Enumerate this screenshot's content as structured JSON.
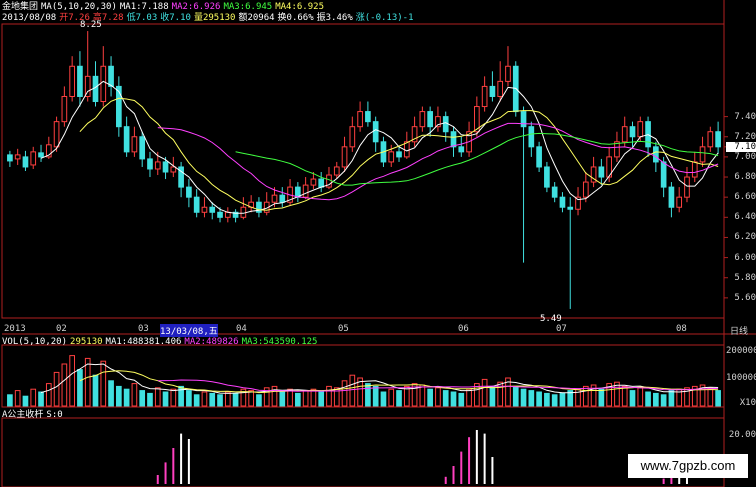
{
  "colors": {
    "up": "#ff4040",
    "down": "#40e0e0",
    "ma1": "#ffffff",
    "ma2": "#ff40ff",
    "ma3": "#40ff40",
    "ma4": "#ffff60",
    "axis": "#b02020"
  },
  "header1": {
    "name": "金地集团",
    "ma_label": "MA(5,10,20,30)",
    "ma1": "MA1:7.188",
    "ma2": "MA2:6.926",
    "ma3": "MA3:6.945",
    "ma4": "MA4:6.925"
  },
  "header2": {
    "date": "2013/08/08",
    "open": "开7.26",
    "high": "高7.28",
    "low": "低7.03",
    "close": "收7.10",
    "vol": "量295130",
    "amount": "额20964",
    "turnover": "换0.66%",
    "amplitude": "振3.46%",
    "change": "涨(-0.13)-1"
  },
  "price_annotations": {
    "high": "8.25",
    "low": "5.49"
  },
  "price_axis": [
    "7.40",
    "7.20",
    "7.10",
    "7.00",
    "6.80",
    "6.60",
    "6.40",
    "6.20",
    "6.00",
    "5.80",
    "5.60"
  ],
  "dates": [
    "2013",
    "02",
    "03",
    "13/03/08,五",
    "04",
    "05",
    "06",
    "07",
    "08",
    "日线"
  ],
  "vol_header": {
    "label": "VOL(5,10,20)",
    "value": "295130",
    "ma1": "MA1:488381.406",
    "ma2": "MA2:489826",
    "ma3": "MA3:543590.125"
  },
  "vol_axis": [
    "200000",
    "100000",
    "X10"
  ],
  "indicator": {
    "label": "A公主收杆",
    "value": "S:0"
  },
  "ind_axis": [
    "20.00"
  ],
  "watermark": "www.7gpzb.com",
  "chart_data": {
    "type": "candlestick",
    "ylim": [
      5.4,
      8.3
    ],
    "candles": [
      [
        7.02,
        6.96,
        7.06,
        6.9
      ],
      [
        6.98,
        7.02,
        7.08,
        6.92
      ],
      [
        7.0,
        6.9,
        7.06,
        6.86
      ],
      [
        6.92,
        7.05,
        7.1,
        6.88
      ],
      [
        7.04,
        7.0,
        7.12,
        6.95
      ],
      [
        7.0,
        7.12,
        7.2,
        6.98
      ],
      [
        7.1,
        7.35,
        7.4,
        7.05
      ],
      [
        7.35,
        7.6,
        7.7,
        7.3
      ],
      [
        7.6,
        7.9,
        8.0,
        7.55
      ],
      [
        7.9,
        7.6,
        8.05,
        7.5
      ],
      [
        7.6,
        7.8,
        8.25,
        7.55
      ],
      [
        7.8,
        7.55,
        7.95,
        7.5
      ],
      [
        7.55,
        7.9,
        8.1,
        7.5
      ],
      [
        7.9,
        7.7,
        8.0,
        7.6
      ],
      [
        7.7,
        7.3,
        7.8,
        7.2
      ],
      [
        7.3,
        7.05,
        7.4,
        7.0
      ],
      [
        7.05,
        7.2,
        7.3,
        7.0
      ],
      [
        7.2,
        6.98,
        7.25,
        6.9
      ],
      [
        6.98,
        6.88,
        7.05,
        6.8
      ],
      [
        6.88,
        6.95,
        7.05,
        6.82
      ],
      [
        6.95,
        6.85,
        7.0,
        6.78
      ],
      [
        6.85,
        6.9,
        7.0,
        6.8
      ],
      [
        6.9,
        6.7,
        6.95,
        6.6
      ],
      [
        6.7,
        6.6,
        6.78,
        6.5
      ],
      [
        6.6,
        6.45,
        6.68,
        6.4
      ],
      [
        6.45,
        6.5,
        6.6,
        6.4
      ],
      [
        6.5,
        6.45,
        6.55,
        6.38
      ],
      [
        6.45,
        6.4,
        6.5,
        6.35
      ],
      [
        6.4,
        6.45,
        6.5,
        6.35
      ],
      [
        6.45,
        6.4,
        6.48,
        6.35
      ],
      [
        6.4,
        6.5,
        6.6,
        6.38
      ],
      [
        6.5,
        6.55,
        6.62,
        6.45
      ],
      [
        6.55,
        6.45,
        6.6,
        6.4
      ],
      [
        6.45,
        6.55,
        6.65,
        6.42
      ],
      [
        6.55,
        6.62,
        6.7,
        6.5
      ],
      [
        6.62,
        6.55,
        6.7,
        6.5
      ],
      [
        6.55,
        6.7,
        6.78,
        6.52
      ],
      [
        6.7,
        6.6,
        6.75,
        6.55
      ],
      [
        6.6,
        6.72,
        6.8,
        6.58
      ],
      [
        6.72,
        6.78,
        6.85,
        6.68
      ],
      [
        6.78,
        6.7,
        6.85,
        6.65
      ],
      [
        6.7,
        6.82,
        6.9,
        6.68
      ],
      [
        6.82,
        6.9,
        6.95,
        6.78
      ],
      [
        6.9,
        7.1,
        7.2,
        6.85
      ],
      [
        7.1,
        7.3,
        7.4,
        7.05
      ],
      [
        7.3,
        7.45,
        7.55,
        7.25
      ],
      [
        7.45,
        7.35,
        7.55,
        7.3
      ],
      [
        7.35,
        7.15,
        7.4,
        7.05
      ],
      [
        7.15,
        6.95,
        7.2,
        6.9
      ],
      [
        6.95,
        7.05,
        7.12,
        6.9
      ],
      [
        7.05,
        7.0,
        7.1,
        6.95
      ],
      [
        7.0,
        7.15,
        7.25,
        6.98
      ],
      [
        7.15,
        7.3,
        7.4,
        7.1
      ],
      [
        7.3,
        7.45,
        7.5,
        7.25
      ],
      [
        7.45,
        7.3,
        7.5,
        7.2
      ],
      [
        7.3,
        7.4,
        7.5,
        7.25
      ],
      [
        7.4,
        7.25,
        7.45,
        7.15
      ],
      [
        7.25,
        7.1,
        7.3,
        7.0
      ],
      [
        7.1,
        7.05,
        7.2,
        7.0
      ],
      [
        7.05,
        7.25,
        7.35,
        7.0
      ],
      [
        7.25,
        7.5,
        7.6,
        7.2
      ],
      [
        7.5,
        7.7,
        7.8,
        7.45
      ],
      [
        7.7,
        7.6,
        7.85,
        7.55
      ],
      [
        7.6,
        7.75,
        7.95,
        7.55
      ],
      [
        7.75,
        7.9,
        8.1,
        7.7
      ],
      [
        7.9,
        7.45,
        7.95,
        7.4
      ],
      [
        7.45,
        7.3,
        7.5,
        5.95
      ],
      [
        7.3,
        7.1,
        7.35,
        7.0
      ],
      [
        7.1,
        6.9,
        7.15,
        6.85
      ],
      [
        6.9,
        6.7,
        6.95,
        6.65
      ],
      [
        6.7,
        6.6,
        6.75,
        6.55
      ],
      [
        6.6,
        6.5,
        6.65,
        6.45
      ],
      [
        6.5,
        6.48,
        6.6,
        5.49
      ],
      [
        6.48,
        6.6,
        6.7,
        6.42
      ],
      [
        6.6,
        6.75,
        6.85,
        6.55
      ],
      [
        6.75,
        6.9,
        7.0,
        6.7
      ],
      [
        6.9,
        6.8,
        6.98,
        6.72
      ],
      [
        6.8,
        7.0,
        7.1,
        6.75
      ],
      [
        7.0,
        7.15,
        7.25,
        6.95
      ],
      [
        7.15,
        7.3,
        7.4,
        7.1
      ],
      [
        7.3,
        7.2,
        7.35,
        7.1
      ],
      [
        7.2,
        7.35,
        7.4,
        7.15
      ],
      [
        7.35,
        7.1,
        7.4,
        7.0
      ],
      [
        7.1,
        6.95,
        7.15,
        6.85
      ],
      [
        6.95,
        6.7,
        7.0,
        6.6
      ],
      [
        6.7,
        6.5,
        6.75,
        6.4
      ],
      [
        6.5,
        6.6,
        6.7,
        6.45
      ],
      [
        6.6,
        6.8,
        6.9,
        6.55
      ],
      [
        6.8,
        6.95,
        7.05,
        6.75
      ],
      [
        6.95,
        7.1,
        7.2,
        6.9
      ],
      [
        7.1,
        7.25,
        7.3,
        7.05
      ],
      [
        7.25,
        7.1,
        7.35,
        7.03
      ]
    ],
    "volumes": [
      40,
      55,
      35,
      60,
      50,
      80,
      120,
      150,
      180,
      130,
      170,
      110,
      160,
      90,
      70,
      60,
      80,
      55,
      45,
      65,
      50,
      60,
      70,
      55,
      40,
      50,
      45,
      40,
      50,
      45,
      60,
      55,
      40,
      65,
      70,
      50,
      60,
      45,
      55,
      60,
      50,
      70,
      65,
      90,
      110,
      100,
      80,
      70,
      50,
      60,
      55,
      70,
      80,
      75,
      60,
      65,
      55,
      50,
      45,
      60,
      80,
      95,
      70,
      85,
      100,
      70,
      60,
      55,
      50,
      45,
      40,
      45,
      55,
      60,
      70,
      75,
      60,
      80,
      85,
      70,
      55,
      65,
      50,
      45,
      40,
      55,
      60,
      65,
      70,
      75,
      65,
      55
    ],
    "indicator": [
      0,
      0,
      0,
      0,
      0,
      0,
      0,
      0,
      0,
      0,
      0,
      0,
      0,
      0,
      0,
      0,
      0,
      0,
      0,
      5,
      12,
      20,
      28,
      25,
      0,
      0,
      0,
      0,
      0,
      0,
      0,
      0,
      0,
      0,
      0,
      0,
      0,
      0,
      0,
      0,
      0,
      0,
      0,
      0,
      0,
      0,
      0,
      0,
      0,
      0,
      0,
      0,
      0,
      0,
      0,
      0,
      4,
      10,
      18,
      26,
      30,
      28,
      15,
      0,
      0,
      0,
      0,
      0,
      0,
      0,
      0,
      0,
      0,
      0,
      0,
      0,
      0,
      0,
      0,
      0,
      0,
      0,
      0,
      0,
      3,
      8,
      14,
      6,
      0,
      0,
      0,
      0
    ]
  }
}
